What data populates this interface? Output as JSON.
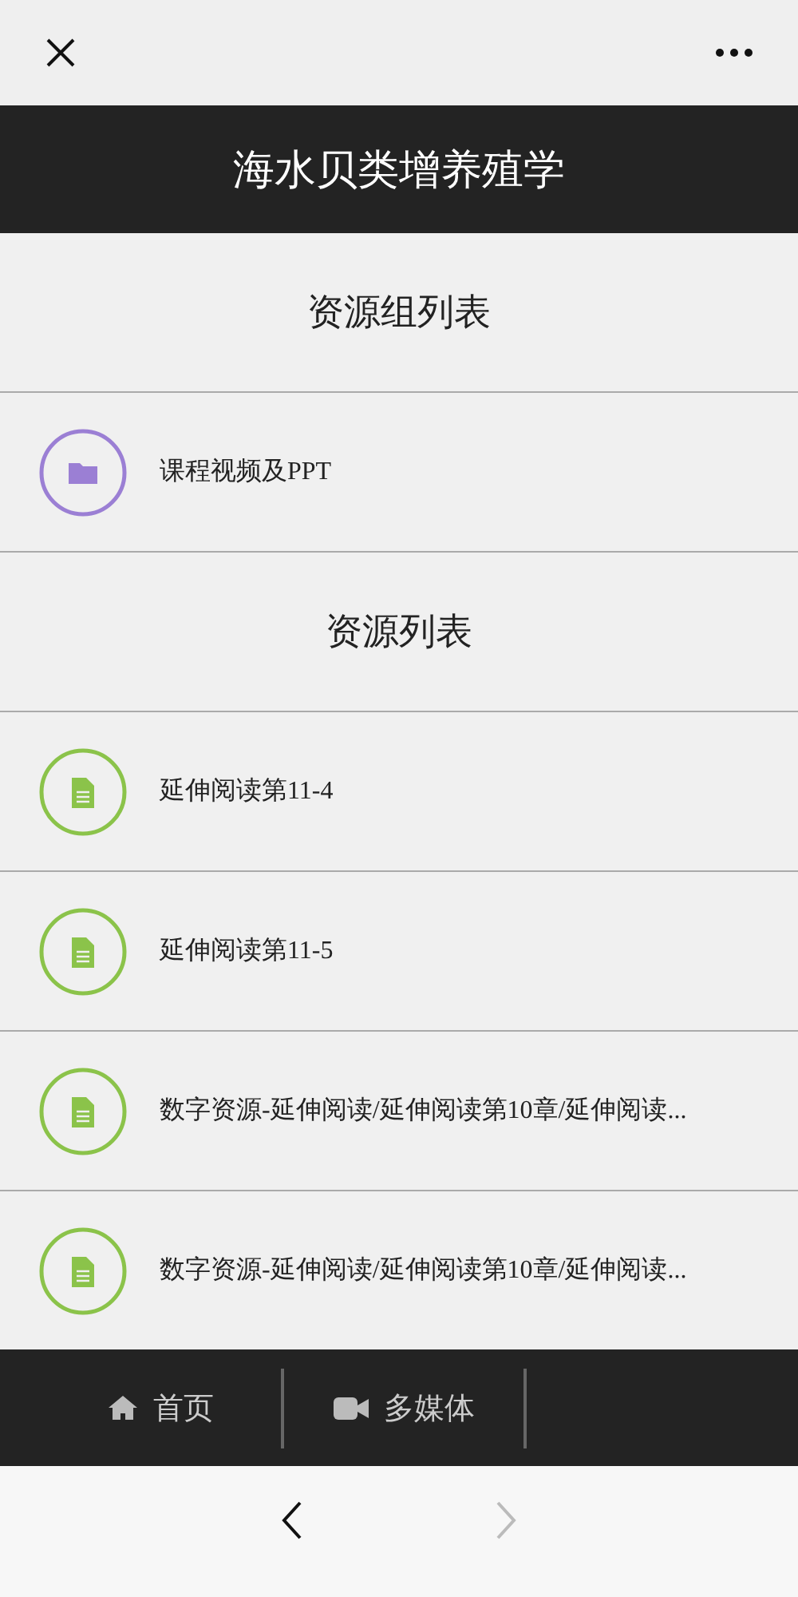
{
  "header": {
    "title": "海水贝类增养殖学"
  },
  "sections": [
    {
      "heading": "资源组列表",
      "items": [
        {
          "kind": "folder",
          "label": "课程视频及PPT"
        }
      ]
    },
    {
      "heading": "资源列表",
      "items": [
        {
          "kind": "document",
          "label": "延伸阅读第11-4"
        },
        {
          "kind": "document",
          "label": "延伸阅读第11-5"
        },
        {
          "kind": "document",
          "label": "数字资源-延伸阅读/延伸阅读第10章/延伸阅读..."
        },
        {
          "kind": "document",
          "label": "数字资源-延伸阅读/延伸阅读第10章/延伸阅读..."
        }
      ]
    }
  ],
  "tab_bar": [
    {
      "kind": "home",
      "label": "首页"
    },
    {
      "kind": "video",
      "label": "多媒体"
    }
  ],
  "browser_nav": {
    "back_disabled": false,
    "forward_disabled": true
  }
}
